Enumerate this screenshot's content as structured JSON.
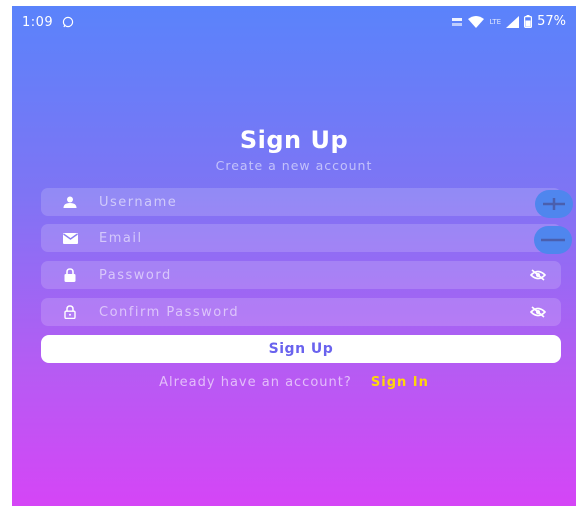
{
  "status_bar": {
    "time": "1:09",
    "network_label": "LTE",
    "battery": "57%",
    "icons": [
      "whatsapp-icon",
      "volte-icon",
      "wifi-icon",
      "signal-icon",
      "battery-icon"
    ]
  },
  "header": {
    "title": "Sign Up",
    "subtitle": "Create a new account"
  },
  "form": {
    "username": {
      "placeholder": "Username",
      "value": "",
      "icon": "person-icon"
    },
    "email": {
      "placeholder": "Email",
      "value": "",
      "icon": "mail-icon"
    },
    "password": {
      "placeholder": "Password",
      "value": "",
      "icon": "lock-icon",
      "toggle_icon": "eye-off-icon"
    },
    "confirm_password": {
      "placeholder": "Confirm Password",
      "value": "",
      "icon": "lock-outline-icon",
      "toggle_icon": "eye-off-icon"
    },
    "submit_label": "Sign Up"
  },
  "footer": {
    "prompt": "Already have an account?",
    "link_label": "Sign In"
  },
  "overlay": {
    "zoom_in_icon": "plus-icon",
    "zoom_out_icon": "minus-icon"
  },
  "colors": {
    "gradient_top": "#5a83fb",
    "gradient_bottom": "#d545f6",
    "link": "#ffd60a",
    "button_text": "#6a63ee",
    "zoom_button": "#4f86ee"
  }
}
